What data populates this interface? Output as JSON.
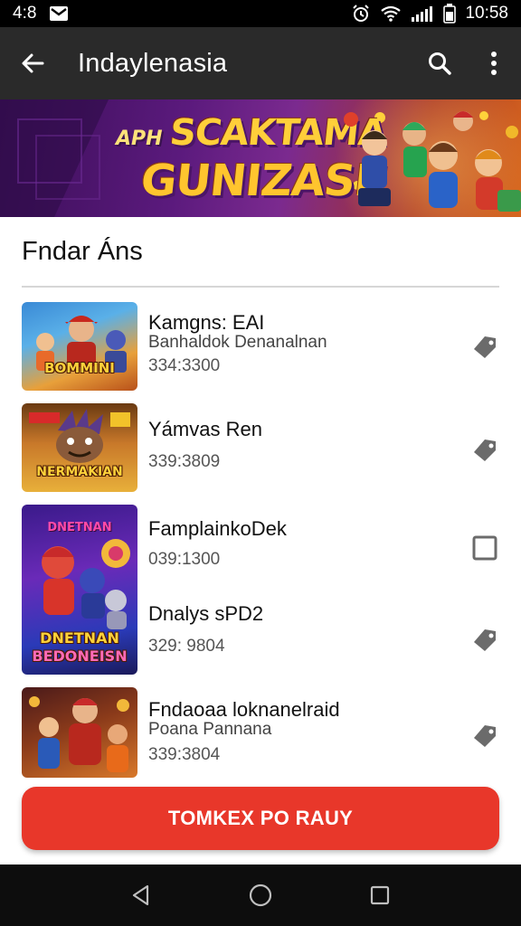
{
  "status_bar": {
    "time_left": "4:8",
    "time_right": "10:58"
  },
  "app_bar": {
    "title": "Indaylenasia"
  },
  "banner": {
    "prefix": "APH",
    "line1": "SCAKTAMA",
    "line2": "GUNIZASI!"
  },
  "section": {
    "title": "Fndar Áns"
  },
  "items": [
    {
      "title": "Kamgns: EAI",
      "subtitle": "Banhaldok Denanalnan",
      "number": "334:3300",
      "thumb_label": "BOMMINI",
      "action_icon": "tag-icon"
    },
    {
      "title": "Yámvas Ren",
      "subtitle": "",
      "number": "339:3809",
      "thumb_label": "NERMAKIAN",
      "action_icon": "tag-icon"
    },
    {
      "title": "FamplainkoDek",
      "subtitle": "",
      "number": "039:1300",
      "thumb_label": "",
      "action_icon": "checkbox-icon"
    },
    {
      "title": "Dnalys sPD2",
      "subtitle": "",
      "number": "329: 9804",
      "thumb_label": "DNETNAN BEDONEISN",
      "action_icon": "tag-icon"
    },
    {
      "title": "Fndaoaa loknanelraid",
      "subtitle": "Poana Pannana",
      "number": "339:3804",
      "thumb_label": "",
      "action_icon": "tag-icon"
    }
  ],
  "tall_thumb": {
    "top_label": "DNETNAN",
    "bottom_label": "BEDONEISN"
  },
  "primary_button": {
    "label": "TOMKEX PO RAUY"
  },
  "colors": {
    "app_bar": "#2a2a2a",
    "accent": "#e8372a",
    "status_bar": "#000000",
    "nav_bar": "#0d0d0d"
  }
}
